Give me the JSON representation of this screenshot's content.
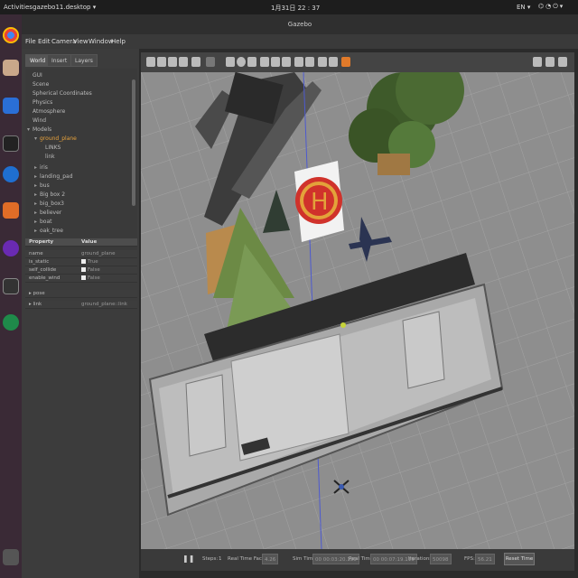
{
  "topbar": {
    "activities": "Activities",
    "app": "gazebo11.desktop ▾",
    "clock": "1月31日 22 : 37",
    "lang": "EN ▾",
    "sys_icons": "⌬◔⏻▾"
  },
  "window": {
    "title": "Gazebo"
  },
  "menu": [
    "File",
    "Edit",
    "Camera",
    "View",
    "Window",
    "Help"
  ],
  "tabs": [
    "World",
    "Insert",
    "Layers"
  ],
  "tree": {
    "top": [
      "GUI",
      "Scene",
      "Spherical Coordinates",
      "Physics",
      "Atmosphere",
      "Wind"
    ],
    "models_label": "Models",
    "selected_model": "ground_plane",
    "children": [
      "LINKS",
      "link"
    ],
    "models": [
      "iris",
      "landing_pad",
      "bus",
      "Big box 2",
      "big_box3",
      "believer",
      "boat",
      "oak_tree"
    ]
  },
  "props": {
    "header_property": "Property",
    "header_value": "Value",
    "rows": [
      {
        "k": "name",
        "v": "ground_plane"
      },
      {
        "k": "is_static",
        "v": "True"
      },
      {
        "k": "self_collide",
        "v": "False"
      },
      {
        "k": "enable_wind",
        "v": "False"
      }
    ],
    "pose": "pose",
    "link_label": "link",
    "link_value": "ground_plane::link"
  },
  "bottom": {
    "steps_label": "Steps:",
    "steps_value": "1",
    "rtf_label": "Real Time Factor:",
    "rtf_value": "4.26",
    "sim_label": "Sim Time",
    "sim_value": "00 00:03:20.130",
    "real_label": "Real Time",
    "real_value": "00 00:07:19.119",
    "iter_label": "Iterations:",
    "iter_value": "50098",
    "fps_label": "FPS:",
    "fps_value": "56.21",
    "reset": "Reset Time"
  },
  "helipad_letter": "H"
}
